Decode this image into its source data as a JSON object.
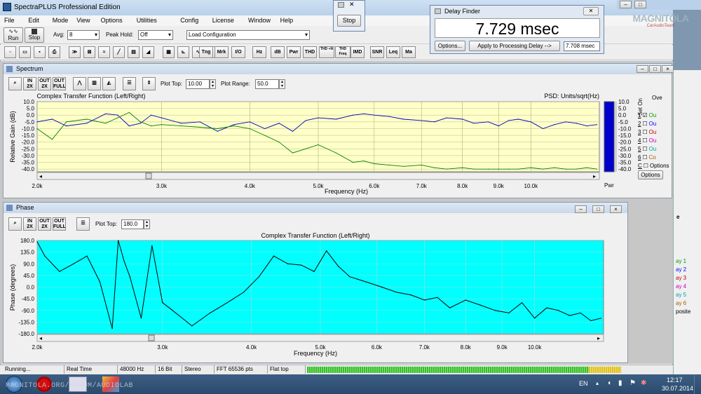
{
  "app": {
    "title": "SpectraPLUS Professional Edition",
    "menu": [
      "File",
      "Edit",
      "Mode",
      "View",
      "Options",
      "Utilities",
      "Config",
      "License",
      "Window",
      "Help"
    ]
  },
  "toolbar": {
    "run": "Run",
    "stop": "Stop",
    "avg_label": "Avg:",
    "avg_value": "8",
    "peak_label": "Peak Hold:",
    "peak_value": "Off",
    "config_value": "Load Configuration",
    "buttons": [
      "Tng",
      "Mrk",
      "I/O",
      "Hz",
      "dB",
      "Pwr",
      "THD",
      "THD +N",
      "THD Freq",
      "IMD",
      "SNR",
      "Leq",
      "Ma"
    ]
  },
  "stop_dialog": {
    "button": "Stop"
  },
  "delay_finder": {
    "title": "Delay Finder",
    "reading": "7.729 msec",
    "options": "Options...",
    "apply": "Apply to Processing Delay -->",
    "value": "7.708 msec"
  },
  "watermark": {
    "text": "MAGNITOLA",
    "sub": "CarAudioTeam"
  },
  "spectrum": {
    "title": "Spectrum",
    "zoom_labels": [
      "IN 2X",
      "OUT 2X",
      "OUT FULL"
    ],
    "plot_top_label": "Plot Top:",
    "plot_top": "10.00",
    "plot_range_label": "Plot Range:",
    "plot_range": "50.0",
    "side_labels": [
      "Ove",
      "Set On",
      "Ou",
      "Ou",
      "Ou",
      "Ou",
      "Ou",
      "Co",
      "Options"
    ],
    "side_nums": [
      "1",
      "2",
      "3",
      "4",
      "5",
      "6",
      "C"
    ],
    "pwr": "Pwr"
  },
  "phase": {
    "title": "Phase",
    "zoom_labels": [
      "IN 2X",
      "OUT 2X",
      "OUT FULL"
    ],
    "plot_top_label": "Plot Top:",
    "plot_top": "180.0"
  },
  "right_panel": {
    "items": [
      "ay 1",
      "ay 2",
      "ay 3",
      "ay 4",
      "ay 5",
      "ay 6",
      "posite"
    ],
    "colors": [
      "#00a000",
      "#0000ff",
      "#c00000",
      "#c000c0",
      "#00a0a0",
      "#a06000"
    ],
    "top": "e"
  },
  "status": {
    "cells": [
      "Running...",
      "Real Time",
      "48000 Hz",
      "16 Bit",
      "Stereo",
      "FFT 65536 pts",
      "Flat top"
    ]
  },
  "taskbar": {
    "lang": "EN",
    "time": "12:17",
    "date": "30.07.2014",
    "url": "MAGNITOLA.ORG/FORUM/AUDIOLAB"
  },
  "chart_data": [
    {
      "type": "line",
      "title": "Complex Transfer Function (Left/Right)",
      "subtitle": "PSD: Units/sqrt(Hz)",
      "xlabel": "Frequency (Hz)",
      "ylabel": "Relative Gain (dB)",
      "xscale": "log",
      "xlim": [
        2000,
        12500
      ],
      "ylim": [
        -42,
        10
      ],
      "x_ticks": [
        "2.0k",
        "3.0k",
        "4.0k",
        "5.0k",
        "6.0k",
        "7.0k",
        "8.0k",
        "9.0k",
        "10.0k"
      ],
      "y_ticks": [
        "10.0",
        "5.0",
        "0.0",
        "-5.0",
        "-10.0",
        "-15.0",
        "-20.0",
        "-25.0",
        "-30.0",
        "-35.0",
        "-40.0"
      ],
      "series": [
        {
          "color": "#0000c0",
          "x": [
            2000,
            2100,
            2200,
            2350,
            2500,
            2600,
            2700,
            2800,
            2900,
            3000,
            3200,
            3400,
            3600,
            3800,
            4000,
            4200,
            4400,
            4600,
            4800,
            5000,
            5300,
            5600,
            5800,
            6000,
            6300,
            6600,
            7000,
            7300,
            7600,
            8000,
            8300,
            8700,
            9000,
            9300,
            9600,
            10000,
            10400,
            10800,
            11200,
            11600,
            12000,
            12400
          ],
          "y": [
            -5,
            -3,
            -8,
            -6,
            1,
            0,
            -8,
            -6,
            0,
            -2,
            -6,
            -5,
            -12,
            -7,
            -5,
            -10,
            -6,
            -12,
            -4,
            -2,
            -3,
            0,
            1,
            0,
            -1,
            -3,
            -4,
            -5,
            -2,
            -3,
            -6,
            -5,
            -8,
            -4,
            -3,
            -5,
            -10,
            -7,
            -5,
            -6,
            -8,
            -7
          ]
        },
        {
          "color": "#008000",
          "x": [
            2000,
            2100,
            2200,
            2350,
            2500,
            2600,
            2700,
            2800,
            2900,
            3000,
            3200,
            3400,
            3600,
            3800,
            4000,
            4200,
            4400,
            4600,
            4800,
            5000,
            5300,
            5600,
            5800,
            6000,
            6300,
            6600,
            7000,
            7300,
            7600,
            8000,
            8300,
            8700,
            9000,
            9300,
            9600,
            10000,
            10400,
            10800,
            11200,
            11600,
            12000,
            12400
          ],
          "y": [
            -10,
            -18,
            -5,
            -3,
            -6,
            -2,
            2,
            -5,
            -8,
            -7,
            -8,
            -9,
            -10,
            -8,
            -10,
            -15,
            -20,
            -28,
            -25,
            -22,
            -28,
            -35,
            -34,
            -36,
            -37,
            -38,
            -37,
            -39,
            -40,
            -39,
            -40,
            -40,
            -40,
            -40,
            -40,
            -39,
            -40,
            -39,
            -40,
            -40,
            -39,
            -40
          ]
        }
      ]
    },
    {
      "type": "line",
      "title": "Complex Transfer Function (Left/Right)",
      "xlabel": "Frequency (Hz)",
      "ylabel": "Phase (degrees)",
      "xscale": "log",
      "xlim": [
        2000,
        12500
      ],
      "ylim": [
        -180,
        180
      ],
      "x_ticks": [
        "2.0k",
        "3.0k",
        "4.0k",
        "5.0k",
        "6.0k",
        "7.0k",
        "8.0k",
        "9.0k",
        "10.0k"
      ],
      "y_ticks": [
        "180.0",
        "135.0",
        "90.0",
        "45.0",
        "0.0",
        "-45.0",
        "-90.0",
        "-135.0",
        "-180.0"
      ],
      "series": [
        {
          "color": "#000000",
          "x": [
            2000,
            2050,
            2150,
            2250,
            2350,
            2450,
            2550,
            2600,
            2650,
            2700,
            2800,
            2900,
            3000,
            3100,
            3300,
            3500,
            3700,
            3900,
            4100,
            4300,
            4500,
            4700,
            4900,
            5100,
            5300,
            5500,
            5800,
            6100,
            6400,
            6700,
            7000,
            7300,
            7600,
            8000,
            8400,
            8800,
            9200,
            9600,
            10000,
            10400,
            10800,
            11200,
            11600,
            12000,
            12400
          ],
          "y": [
            175,
            120,
            60,
            90,
            120,
            20,
            -160,
            180,
            100,
            40,
            -120,
            160,
            -60,
            -90,
            -150,
            -100,
            -60,
            -20,
            40,
            120,
            90,
            85,
            60,
            140,
            80,
            40,
            20,
            0,
            -20,
            -30,
            -50,
            -40,
            -80,
            -50,
            -70,
            -90,
            -100,
            -60,
            -120,
            -80,
            -90,
            -110,
            -100,
            -130,
            -120
          ]
        }
      ]
    }
  ]
}
